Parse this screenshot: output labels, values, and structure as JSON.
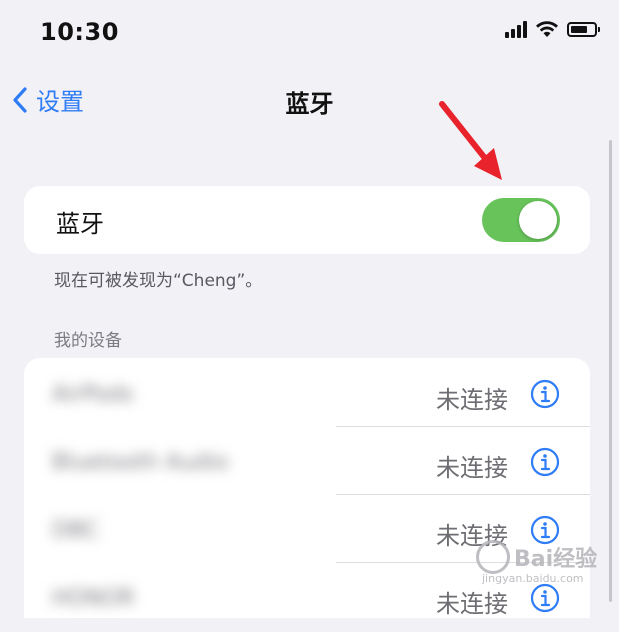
{
  "status_bar": {
    "time": "10:30"
  },
  "nav": {
    "back_label": "设置",
    "title": "蓝牙"
  },
  "bluetooth": {
    "label": "蓝牙",
    "enabled": true,
    "discoverable_note": "现在可被发现为“Cheng”。"
  },
  "my_devices": {
    "header": "我的设备",
    "items": [
      {
        "name": "AirPods",
        "status": "未连接"
      },
      {
        "name": "Bluetooth Audio",
        "status": "未连接"
      },
      {
        "name": "DBC",
        "status": "未连接"
      },
      {
        "name": "HONOR",
        "status": "未连接"
      }
    ]
  },
  "watermark": {
    "brand": "Bai经验",
    "sub": "jingyan.baidu.com"
  },
  "colors": {
    "accent": "#2f7df6",
    "toggle_on": "#67c35a",
    "annotation_arrow": "#e8232b",
    "background": "#f2f1f6"
  }
}
